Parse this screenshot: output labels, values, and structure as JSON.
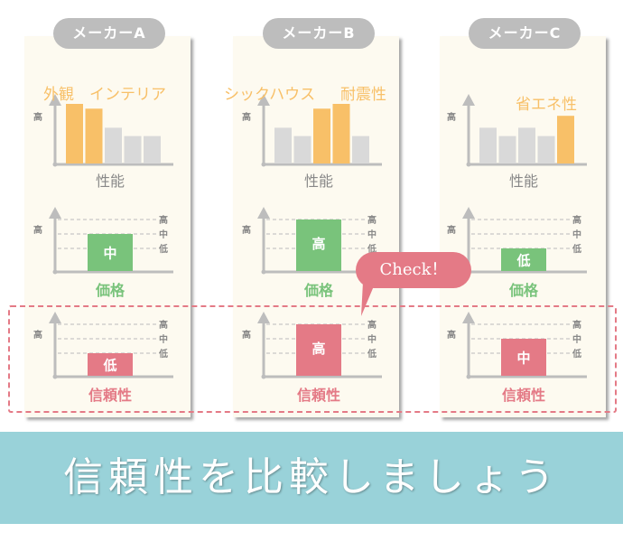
{
  "colors": {
    "highlight_orange": "#f8c068",
    "bar_gray": "#d9d9d9",
    "axis_gray": "#bdbdbd",
    "price_green": "#79c37b",
    "reliability_pink": "#e47a86",
    "panel_bg": "#fdfaf0",
    "banner_bg": "#99d2d9"
  },
  "axis_labels": {
    "y_high": "高",
    "level_high": "高",
    "level_mid": "中",
    "level_low": "低"
  },
  "callout": {
    "label": "Check！"
  },
  "banner": {
    "text": "信頼性を比較しましょう"
  },
  "chart_data": [
    {
      "type": "bar",
      "maker": "メーカーA",
      "title": "性能",
      "highlight_labels": [
        "外観",
        "インテリア"
      ],
      "values": [
        5,
        4.6,
        3,
        2.3,
        2.3
      ],
      "highlighted": [
        true,
        true,
        false,
        false,
        false
      ],
      "price": {
        "title": "価格",
        "level": "中"
      },
      "reliability": {
        "title": "信頼性",
        "level": "低"
      }
    },
    {
      "type": "bar",
      "maker": "メーカーB",
      "title": "性能",
      "highlight_labels": [
        "シックハウス",
        "耐震性"
      ],
      "values": [
        3,
        2.3,
        4.6,
        5,
        2.3
      ],
      "highlighted": [
        false,
        false,
        true,
        true,
        false
      ],
      "price": {
        "title": "価格",
        "level": "高"
      },
      "reliability": {
        "title": "信頼性",
        "level": "高"
      }
    },
    {
      "type": "bar",
      "maker": "メーカーC",
      "title": "性能",
      "highlight_labels": [
        "省エネ性"
      ],
      "values": [
        3,
        2.3,
        3,
        2.3,
        4
      ],
      "highlighted": [
        false,
        false,
        false,
        false,
        true
      ],
      "price": {
        "title": "価格",
        "level": "低"
      },
      "reliability": {
        "title": "信頼性",
        "level": "中"
      }
    }
  ]
}
